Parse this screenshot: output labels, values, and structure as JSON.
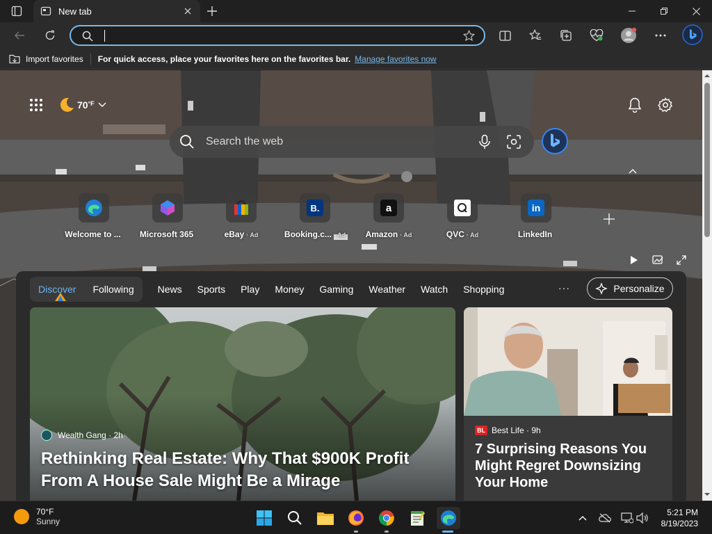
{
  "browser": {
    "tab_title": "New tab",
    "address_value": "",
    "favorites_import": "Import favorites",
    "favorites_hint": "For quick access, place your favorites here on the favorites bar.",
    "favorites_link": "Manage favorites now"
  },
  "newtab": {
    "weather_temp": "70",
    "weather_unit": "°F",
    "search_placeholder": "Search the web",
    "tiles": [
      {
        "label": "Welcome to ...",
        "ad": ""
      },
      {
        "label": "Microsoft 365",
        "ad": ""
      },
      {
        "label": "eBay",
        "ad": "· Ad"
      },
      {
        "label": "Booking.c...",
        "ad": "· Ad"
      },
      {
        "label": "Amazon",
        "ad": "· Ad"
      },
      {
        "label": "QVC",
        "ad": "· Ad"
      },
      {
        "label": "LinkedIn",
        "ad": ""
      }
    ]
  },
  "feed": {
    "tabs": {
      "discover": "Discover",
      "following": "Following"
    },
    "nav": [
      "News",
      "Sports",
      "Play",
      "Money",
      "Gaming",
      "Weather",
      "Watch",
      "Shopping"
    ],
    "more": "···",
    "personalize": "Personalize",
    "main_card": {
      "source": "Wealth Gang · 2h",
      "title": "Rethinking Real Estate: Why That $900K Profit From A House Sale Might Be a Mirage"
    },
    "side_card": {
      "source_logo": "BL",
      "source": "Best Life · 9h",
      "title": "7 Surprising Reasons You Might Regret Downsizing Your Home"
    }
  },
  "taskbar": {
    "weather_temp": "70°F",
    "weather_desc": "Sunny",
    "time": "5:21 PM",
    "date": "8/19/2023"
  },
  "colors": {
    "accent": "#6cb4f2",
    "address_border": "#79b8e9",
    "sun": "#f59a0c"
  }
}
